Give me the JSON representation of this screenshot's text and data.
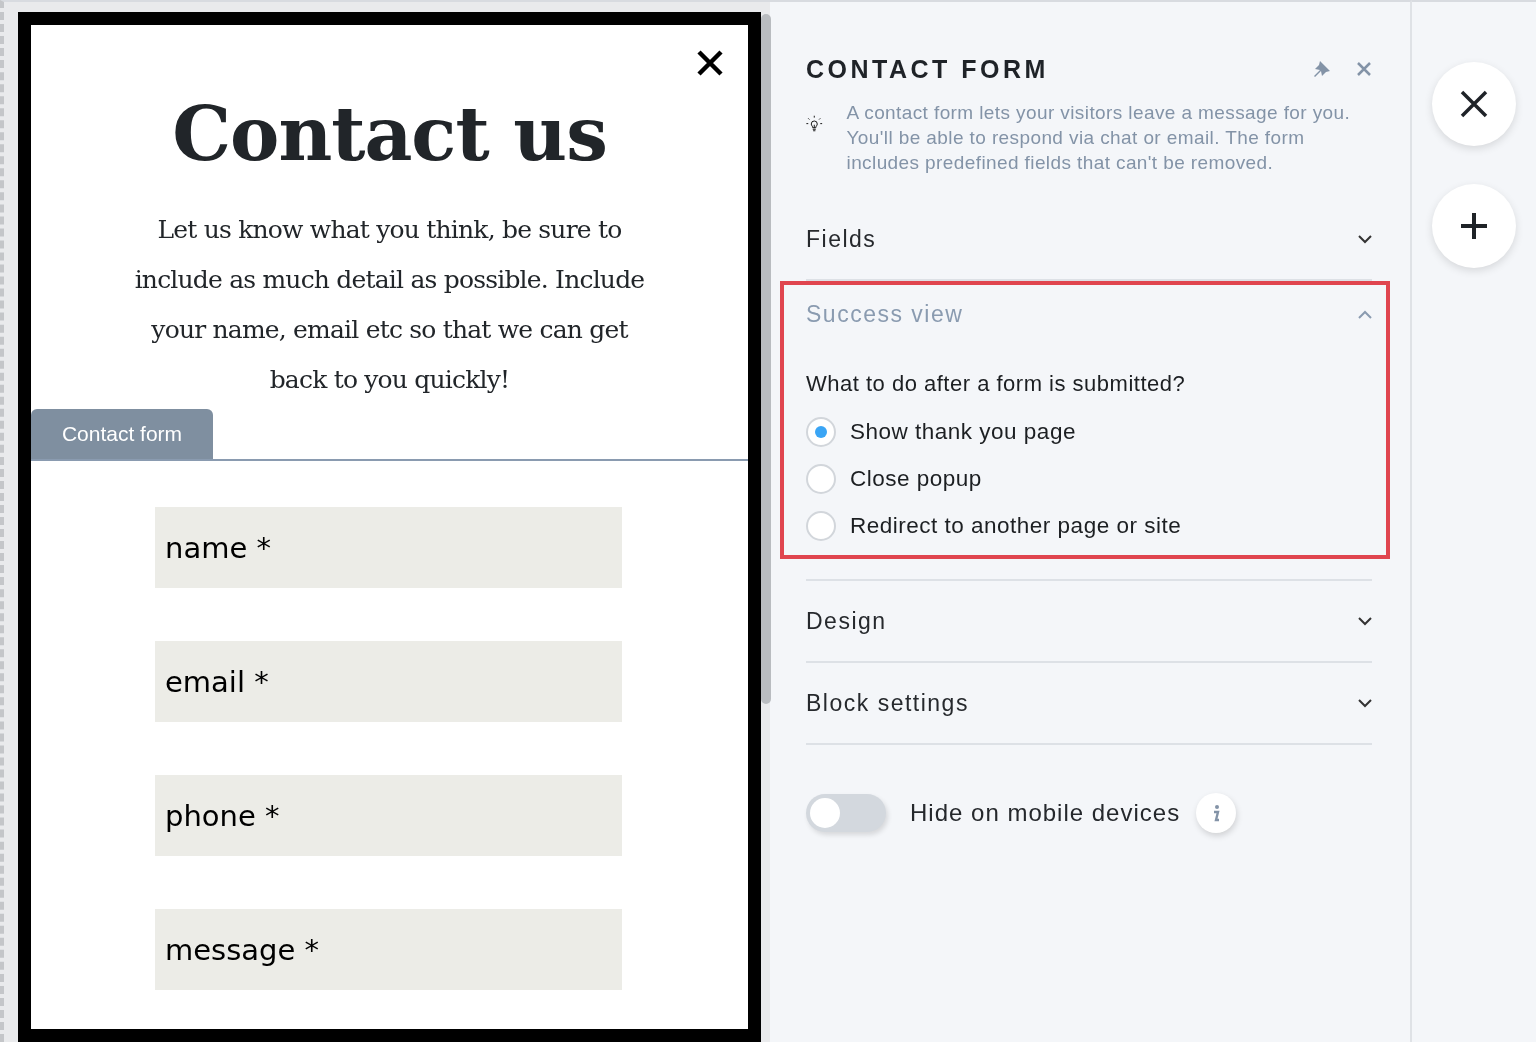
{
  "popup": {
    "title": "Contact us",
    "intro": "Let us know what you think, be sure to include as much detail as possible. Include your name, email etc so that we can get back to you quickly!",
    "tab": "Contact form",
    "fields": [
      {
        "placeholder": "name *"
      },
      {
        "placeholder": "email *"
      },
      {
        "placeholder": "phone *"
      },
      {
        "placeholder": "message *"
      }
    ]
  },
  "panel": {
    "title": "CONTACT FORM",
    "description": "A contact form lets your visitors leave a message for you. You'll be able to respond via chat or email. The form includes predefined fields that can't be removed.",
    "sections": [
      {
        "title": "Fields",
        "expanded": false,
        "highlighted": false
      },
      {
        "title": "Success view",
        "expanded": true,
        "highlighted": true,
        "question": "What to do after a form is submitted?",
        "options": [
          {
            "label": "Show thank you page",
            "selected": true
          },
          {
            "label": "Close popup",
            "selected": false
          },
          {
            "label": "Redirect to another page or site",
            "selected": false
          }
        ]
      },
      {
        "title": "Design",
        "expanded": false,
        "highlighted": false
      },
      {
        "title": "Block settings",
        "expanded": false,
        "highlighted": false
      }
    ],
    "toggle": {
      "label": "Hide on mobile devices",
      "on": false
    }
  }
}
